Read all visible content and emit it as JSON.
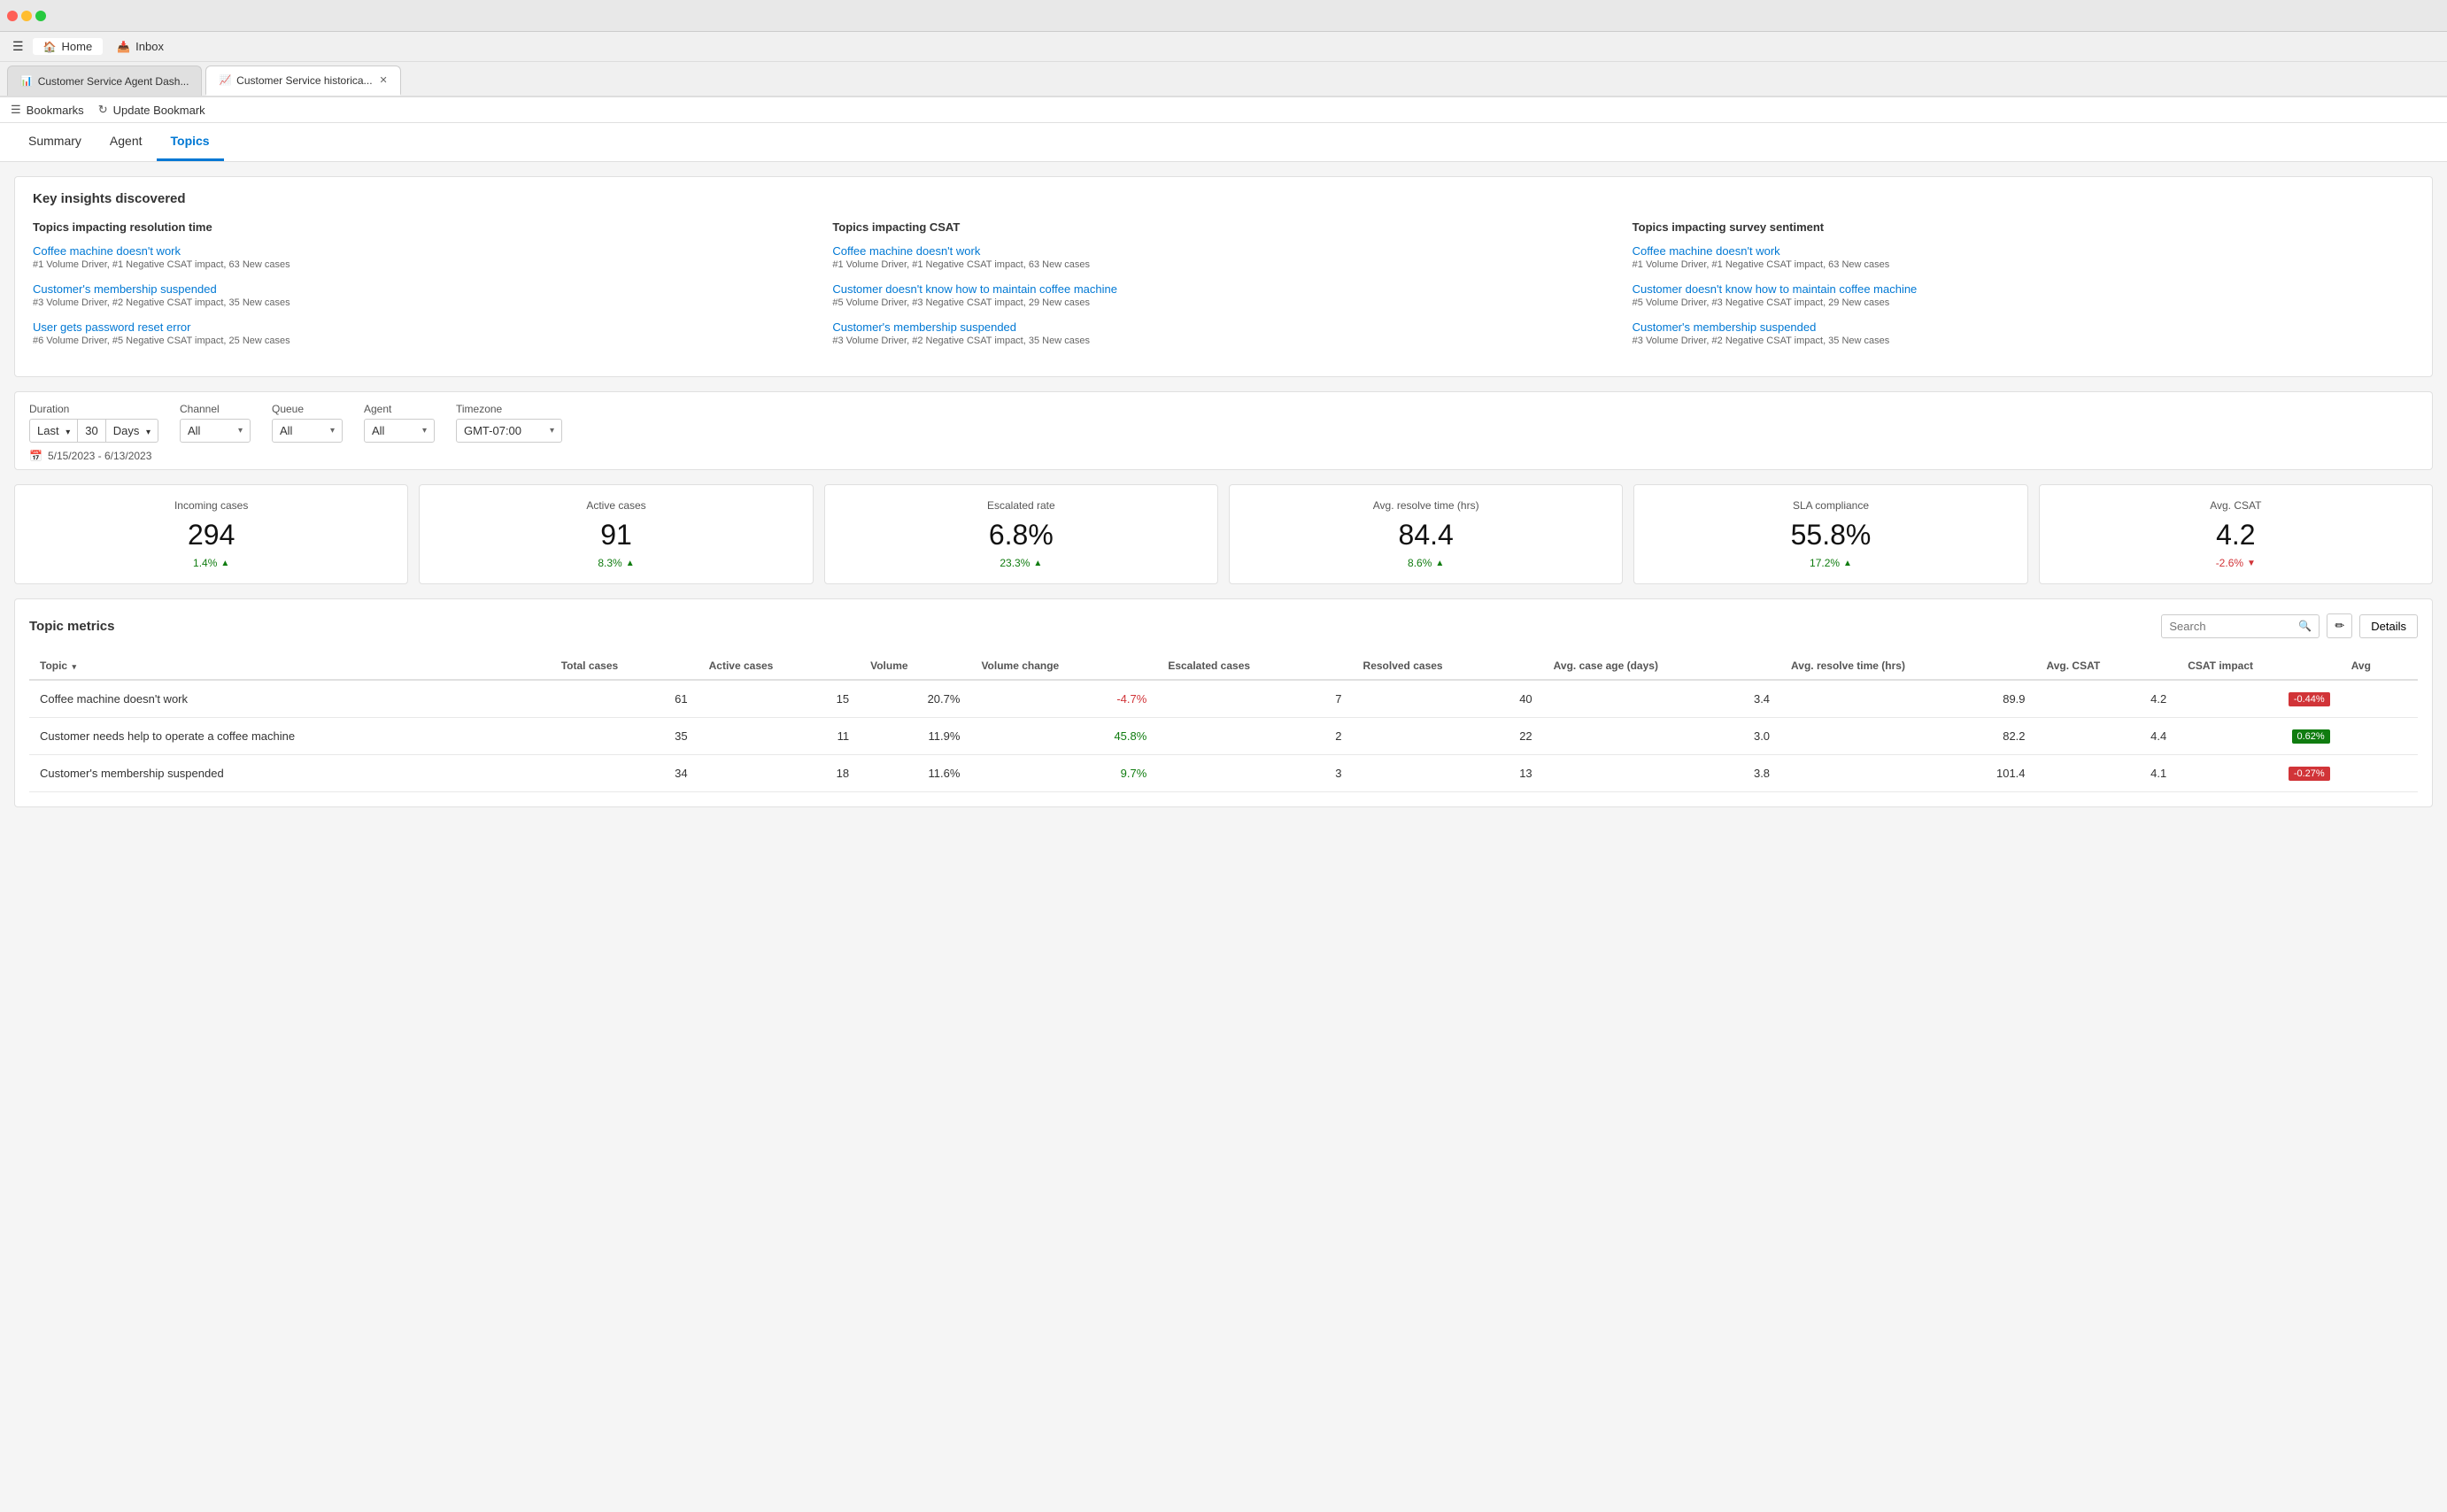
{
  "browser": {
    "tabs": [
      {
        "id": "tab1",
        "label": "Customer Service Agent Dash...",
        "icon": "📊",
        "active": false
      },
      {
        "id": "tab2",
        "label": "Customer Service historica...",
        "icon": "📈",
        "active": true
      }
    ],
    "nav_items": [
      {
        "id": "home",
        "label": "Home",
        "active": true
      },
      {
        "id": "inbox",
        "label": "Inbox",
        "active": false
      }
    ]
  },
  "bookmarks": {
    "items": [
      {
        "id": "bookmarks",
        "icon": "☰",
        "label": "Bookmarks"
      },
      {
        "id": "update",
        "icon": "↻",
        "label": "Update Bookmark"
      }
    ]
  },
  "main_nav": {
    "items": [
      {
        "id": "summary",
        "label": "Summary",
        "active": false
      },
      {
        "id": "agent",
        "label": "Agent",
        "active": false
      },
      {
        "id": "topics",
        "label": "Topics",
        "active": true
      }
    ]
  },
  "insights": {
    "title": "Key insights discovered",
    "columns": [
      {
        "heading": "Topics impacting resolution time",
        "items": [
          {
            "link": "Coffee machine doesn't work",
            "meta": "#1 Volume Driver, #1 Negative CSAT impact, 63 New cases"
          },
          {
            "link": "Customer's membership suspended",
            "meta": "#3 Volume Driver, #2 Negative CSAT impact, 35 New cases"
          },
          {
            "link": "User gets password reset error",
            "meta": "#6 Volume Driver, #5 Negative CSAT impact, 25 New cases"
          }
        ]
      },
      {
        "heading": "Topics impacting CSAT",
        "items": [
          {
            "link": "Coffee machine doesn't work",
            "meta": "#1 Volume Driver, #1 Negative CSAT impact, 63 New cases"
          },
          {
            "link": "Customer doesn't know how to maintain coffee machine",
            "meta": "#5 Volume Driver, #3 Negative CSAT impact, 29 New cases"
          },
          {
            "link": "Customer's membership suspended",
            "meta": "#3 Volume Driver, #2 Negative CSAT impact, 35 New cases"
          }
        ]
      },
      {
        "heading": "Topics impacting survey sentiment",
        "items": [
          {
            "link": "Coffee machine doesn't work",
            "meta": "#1 Volume Driver, #1 Negative CSAT impact, 63 New cases"
          },
          {
            "link": "Customer doesn't know how to maintain coffee machine",
            "meta": "#5 Volume Driver, #3 Negative CSAT impact, 29 New cases"
          },
          {
            "link": "Customer's membership suspended",
            "meta": "#3 Volume Driver, #2 Negative CSAT impact, 35 New cases"
          }
        ]
      }
    ]
  },
  "filters": {
    "duration_label": "Duration",
    "duration_preset": "Last",
    "duration_value": "30",
    "duration_unit": "Days",
    "channel_label": "Channel",
    "channel_value": "All",
    "queue_label": "Queue",
    "queue_value": "All",
    "agent_label": "Agent",
    "agent_value": "All",
    "timezone_label": "Timezone",
    "timezone_value": "GMT-07:00",
    "date_range": "5/15/2023 - 6/13/2023"
  },
  "metrics": [
    {
      "label": "Incoming cases",
      "value": "294",
      "change": "1.4%",
      "direction": "up"
    },
    {
      "label": "Active cases",
      "value": "91",
      "change": "8.3%",
      "direction": "up"
    },
    {
      "label": "Escalated rate",
      "value": "6.8%",
      "change": "23.3%",
      "direction": "up"
    },
    {
      "label": "Avg. resolve time (hrs)",
      "value": "84.4",
      "change": "8.6%",
      "direction": "up"
    },
    {
      "label": "SLA compliance",
      "value": "55.8%",
      "change": "17.2%",
      "direction": "up"
    },
    {
      "label": "Avg. CSAT",
      "value": "4.2",
      "change": "-2.6%",
      "direction": "down"
    }
  ],
  "topic_metrics": {
    "title": "Topic metrics",
    "search_placeholder": "Search",
    "details_label": "Details",
    "columns": [
      "Topic",
      "Total cases",
      "Active cases",
      "Volume",
      "Volume change",
      "Escalated cases",
      "Resolved cases",
      "Avg. case age (days)",
      "Avg. resolve time (hrs)",
      "Avg. CSAT",
      "CSAT impact",
      "Avg"
    ],
    "rows": [
      {
        "topic": "Coffee machine doesn't work",
        "total_cases": "61",
        "active_cases": "15",
        "volume": "20.7%",
        "volume_change": "-4.7%",
        "escalated_cases": "7",
        "resolved_cases": "40",
        "avg_case_age": "3.4",
        "avg_resolve_time": "89.9",
        "avg_csat": "4.2",
        "csat_impact": "-0.44%",
        "csat_impact_color": "red"
      },
      {
        "topic": "Customer needs help to operate a coffee machine",
        "total_cases": "35",
        "active_cases": "11",
        "volume": "11.9%",
        "volume_change": "45.8%",
        "escalated_cases": "2",
        "resolved_cases": "22",
        "avg_case_age": "3.0",
        "avg_resolve_time": "82.2",
        "avg_csat": "4.4",
        "csat_impact": "0.62%",
        "csat_impact_color": "green"
      },
      {
        "topic": "Customer's membership suspended",
        "total_cases": "34",
        "active_cases": "18",
        "volume": "11.6%",
        "volume_change": "9.7%",
        "escalated_cases": "3",
        "resolved_cases": "13",
        "avg_case_age": "3.8",
        "avg_resolve_time": "101.4",
        "avg_csat": "4.1",
        "csat_impact": "-0.27%",
        "csat_impact_color": "red"
      }
    ]
  }
}
